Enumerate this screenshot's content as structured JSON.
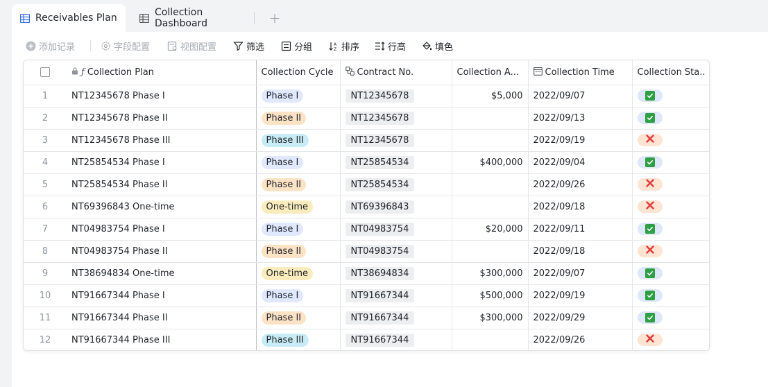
{
  "tabs": [
    {
      "label": "Receivables Plan",
      "active": true
    },
    {
      "label": "Collection Dashboard",
      "active": false
    }
  ],
  "add_tab_symbol": "+",
  "toolbar": {
    "add_record": "添加记录",
    "field_config": "字段配置",
    "view_config": "视图配置",
    "filter": "筛选",
    "group": "分组",
    "sort": "排序",
    "row_height": "行高",
    "fill": "填色"
  },
  "columns": {
    "plan": "Collection Plan",
    "cycle": "Collection Cycle",
    "contract": "Contract No.",
    "amount": "Collection A...",
    "time": "Collection Time",
    "status": "Collection Sta..."
  },
  "status_colors": {
    "paid": "#2ea043",
    "unpaid": "#e5383b"
  },
  "rows": [
    {
      "num": "1",
      "plan": "NT12345678 Phase I",
      "cycle": "Phase I",
      "contract": "NT12345678",
      "amount": "$5,000",
      "time": "2022/09/07",
      "status": "paid"
    },
    {
      "num": "2",
      "plan": "NT12345678 Phase II",
      "cycle": "Phase II",
      "contract": "NT12345678",
      "amount": "",
      "time": "2022/09/13",
      "status": "paid"
    },
    {
      "num": "3",
      "plan": "NT12345678 Phase III",
      "cycle": "Phase III",
      "contract": "NT12345678",
      "amount": "",
      "time": "2022/09/19",
      "status": "unpaid"
    },
    {
      "num": "4",
      "plan": "NT25854534 Phase I",
      "cycle": "Phase I",
      "contract": "NT25854534",
      "amount": "$400,000",
      "time": "2022/09/04",
      "status": "paid"
    },
    {
      "num": "5",
      "plan": "NT25854534 Phase II",
      "cycle": "Phase II",
      "contract": "NT25854534",
      "amount": "",
      "time": "2022/09/26",
      "status": "unpaid"
    },
    {
      "num": "6",
      "plan": "NT69396843 One-time",
      "cycle": "One-time",
      "contract": "NT69396843",
      "amount": "",
      "time": "2022/09/18",
      "status": "unpaid"
    },
    {
      "num": "7",
      "plan": "NT04983754 Phase I",
      "cycle": "Phase I",
      "contract": "NT04983754",
      "amount": "$20,000",
      "time": "2022/09/11",
      "status": "paid"
    },
    {
      "num": "8",
      "plan": "NT04983754 Phase II",
      "cycle": "Phase II",
      "contract": "NT04983754",
      "amount": "",
      "time": "2022/09/18",
      "status": "unpaid"
    },
    {
      "num": "9",
      "plan": "NT38694834 One-time",
      "cycle": "One-time",
      "contract": "NT38694834",
      "amount": "$300,000",
      "time": "2022/09/07",
      "status": "paid"
    },
    {
      "num": "10",
      "plan": "NT91667344 Phase I",
      "cycle": "Phase I",
      "contract": "NT91667344",
      "amount": "$500,000",
      "time": "2022/09/19",
      "status": "paid"
    },
    {
      "num": "11",
      "plan": "NT91667344 Phase II",
      "cycle": "Phase II",
      "contract": "NT91667344",
      "amount": "$300,000",
      "time": "2022/09/29",
      "status": "paid"
    },
    {
      "num": "12",
      "plan": "NT91667344 Phase III",
      "cycle": "Phase III",
      "contract": "NT91667344",
      "amount": "",
      "time": "2022/09/26",
      "status": "unpaid"
    }
  ]
}
